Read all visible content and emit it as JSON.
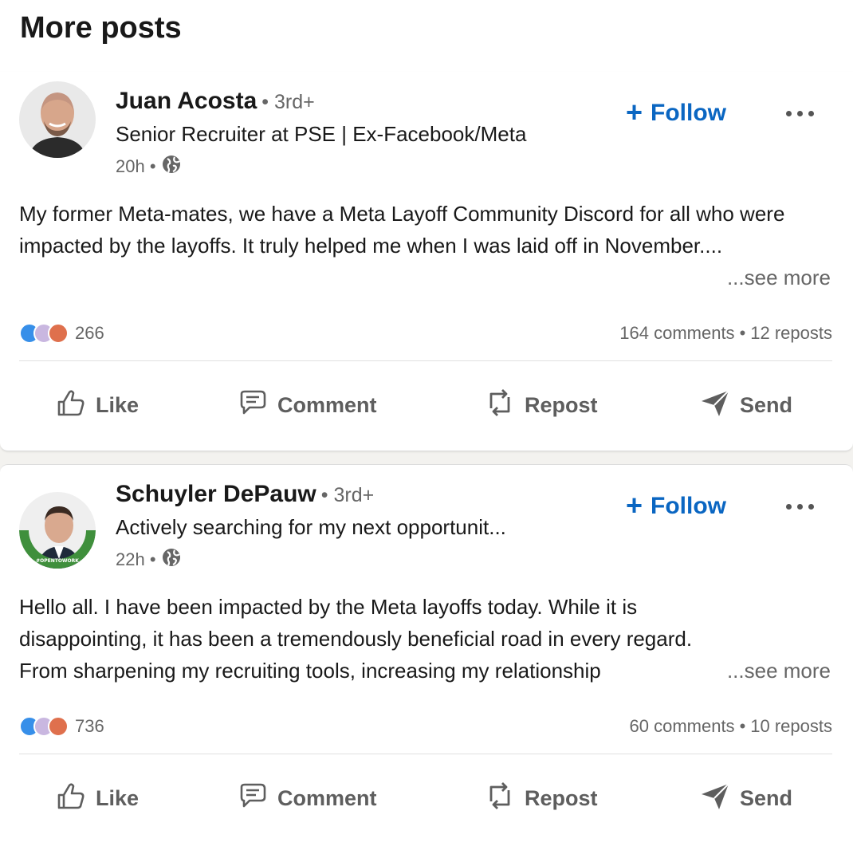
{
  "section": {
    "title": "More posts"
  },
  "colors": {
    "accent": "#0a66c2",
    "muted": "#666666"
  },
  "posts": [
    {
      "author": "Juan Acosta",
      "degree": "• 3rd+",
      "headline": "Senior Recruiter at PSE | Ex-Facebook/Meta",
      "time": "20h •",
      "visibility_icon": "globe-icon",
      "follow_label": "Follow",
      "text": "My former Meta-mates, we have a Meta Layoff Community Discord for all who were impacted by the layoffs. It truly helped me when I was laid off in November....",
      "see_more": "...see more",
      "reaction_count": "266",
      "comments": "164 comments",
      "separator": "•",
      "reposts": "12 reposts",
      "actions": {
        "like": "Like",
        "comment": "Comment",
        "repost": "Repost",
        "send": "Send"
      }
    },
    {
      "author": "Schuyler DePauw",
      "degree": "• 3rd+",
      "headline": "Actively searching for my next opportunit...",
      "time": "22h •",
      "visibility_icon": "globe-icon",
      "follow_label": "Follow",
      "avatar_frame_text": "#OPENTOWORK",
      "text": "Hello all. I have been impacted by the Meta layoffs today. While it is disappointing, it has been a tremendously beneficial road in every regard. From sharpening my recruiting tools, increasing my relationship",
      "see_more": "...see more",
      "reaction_count": "736",
      "comments": "60 comments",
      "separator": "•",
      "reposts": "10 reposts",
      "actions": {
        "like": "Like",
        "comment": "Comment",
        "repost": "Repost",
        "send": "Send"
      }
    }
  ]
}
